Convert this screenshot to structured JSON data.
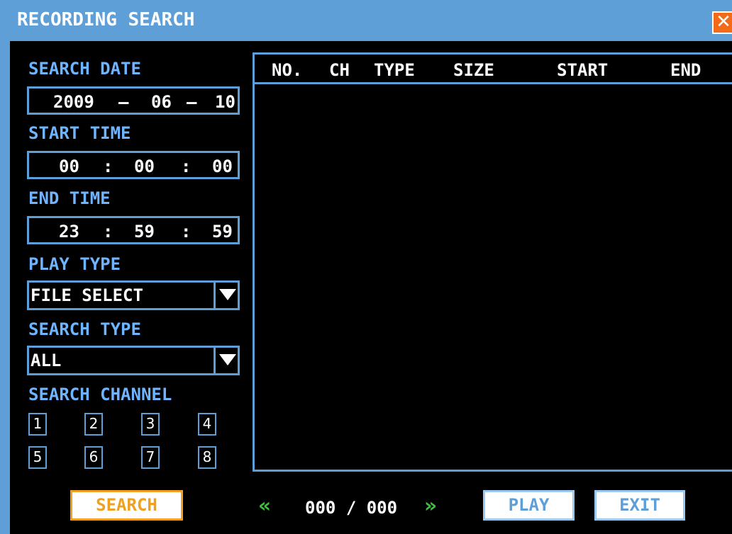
{
  "window": {
    "title": "RECORDING SEARCH",
    "close_glyph": "✕"
  },
  "search_date": {
    "label": "SEARCH DATE",
    "year": "2009",
    "sep1": "–",
    "month": "06",
    "sep2": "–",
    "day": "10"
  },
  "start_time": {
    "label": "START TIME",
    "h": "00",
    "sep1": ":",
    "m": "00",
    "sep2": ":",
    "s": "00"
  },
  "end_time": {
    "label": "END TIME",
    "h": "23",
    "sep1": ":",
    "m": "59",
    "sep2": ":",
    "s": "59"
  },
  "play_type": {
    "label": "PLAY TYPE",
    "value": "FILE SELECT"
  },
  "search_type": {
    "label": "SEARCH TYPE",
    "value": "ALL"
  },
  "search_channel": {
    "label": "SEARCH CHANNEL",
    "channels": [
      "1",
      "2",
      "3",
      "4",
      "5",
      "6",
      "7",
      "8"
    ]
  },
  "list": {
    "columns": [
      "NO.",
      "CH",
      "TYPE",
      "SIZE",
      "START",
      "END"
    ],
    "rows": []
  },
  "footer": {
    "search_label": "SEARCH",
    "prev_glyph": "«",
    "next_glyph": "»",
    "current_page": "000",
    "page_sep": "/",
    "total_pages": "000",
    "play_label": "PLAY",
    "exit_label": "EXIT"
  },
  "colors": {
    "frame": "#5f9fd8",
    "label": "#6fb4ff",
    "search_btn": "#f0a020",
    "nav_arrow": "#3ebf3e",
    "close": "#f36b18"
  }
}
